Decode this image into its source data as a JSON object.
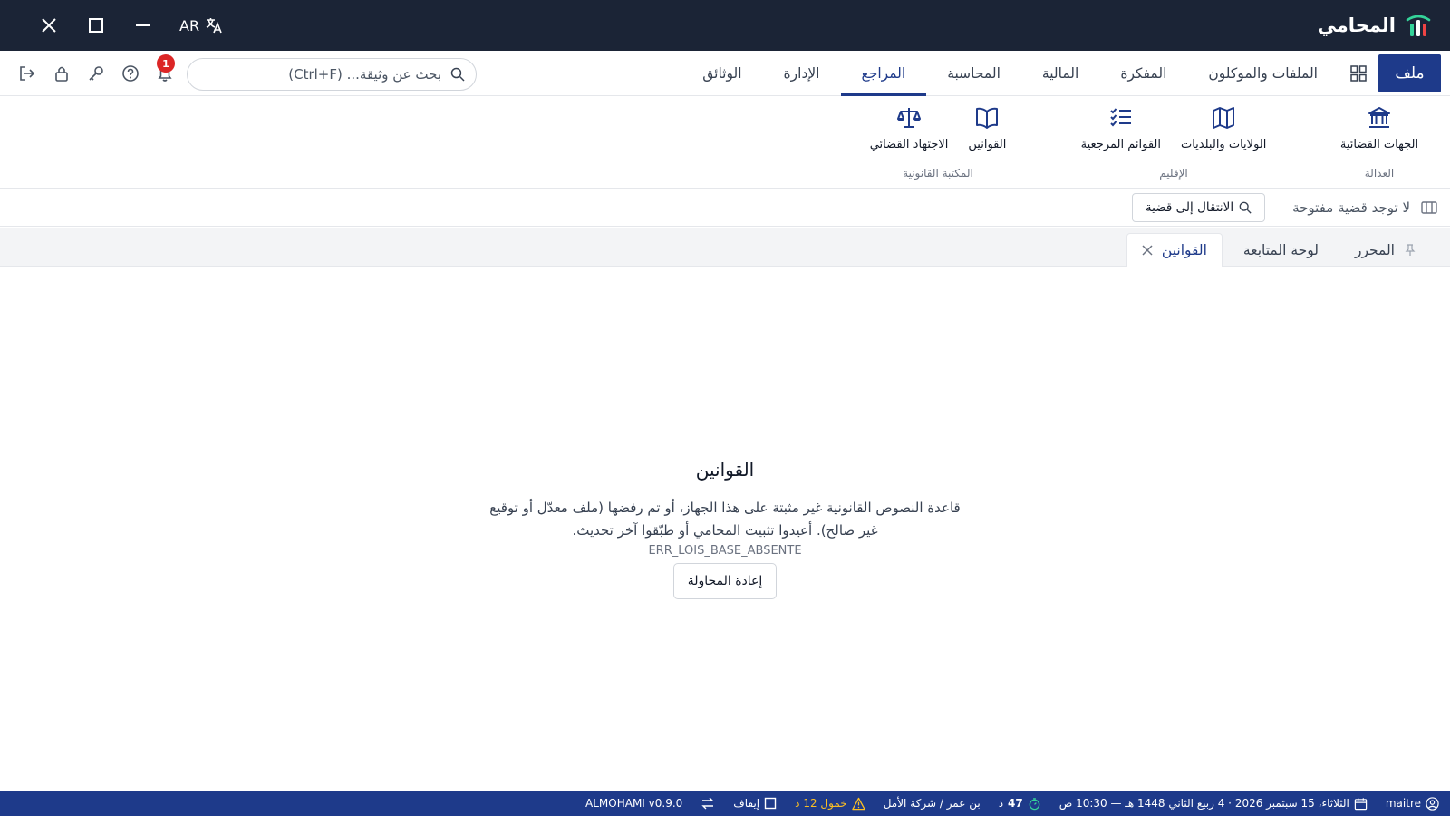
{
  "app": {
    "name": "المحامي",
    "lang_label": "AR",
    "colors": {
      "titlebar": "#1b2436",
      "accent": "#1e3a8a",
      "statusbar": "#1e3a8a",
      "badge": "#dc2626",
      "warning": "#fbbf24"
    }
  },
  "menu": {
    "file_label": "ملف",
    "tabs": [
      "الملفات والموكلون",
      "المفكرة",
      "المالية",
      "المحاسبة",
      "المراجع",
      "الإدارة",
      "الوثائق"
    ],
    "active_tab": "المراجع",
    "search_placeholder": "بحث عن وثيقة... (Ctrl+F)",
    "notification_count": "1"
  },
  "ribbon": {
    "groups": [
      {
        "label": "العدالة",
        "items": [
          {
            "label": "الجهات القضائية",
            "icon": "courthouse-icon"
          }
        ]
      },
      {
        "label": "الإقليم",
        "items": [
          {
            "label": "الولايات والبلديات",
            "icon": "map-icon"
          },
          {
            "label": "القوائم المرجعية",
            "icon": "checklist-icon"
          }
        ]
      },
      {
        "label": "المكتبة القانونية",
        "items": [
          {
            "label": "القوانين",
            "icon": "book-icon"
          },
          {
            "label": "الاجتهاد القضائي",
            "icon": "scales-icon"
          }
        ]
      }
    ]
  },
  "casebar": {
    "no_case_text": "لا توجد قضية مفتوحة",
    "goto_case_label": "الانتقال إلى قضية"
  },
  "doc_tabs": {
    "pinned": "المحرر",
    "tabs": [
      "لوحة المتابعة",
      "القوانين"
    ],
    "active": "القوانين"
  },
  "error": {
    "title": "القوانين",
    "message": "قاعدة النصوص القانونية غير مثبتة على هذا الجهاز، أو تم رفضها (ملف معدّل أو توقيع غير صالح). أعيدوا تثبيت المحامي أو طبّقوا آخر تحديث.",
    "code": "ERR_LOIS_BASE_ABSENTE",
    "retry_label": "إعادة المحاولة"
  },
  "status": {
    "user": "maitre",
    "date": "الثلاثاء، 15 سبتمبر 2026 · 4 ربيع الثاني 1448 هـ — 10:30 ص",
    "timer_value": "47",
    "timer_unit": "د",
    "office": "بن عمر / شركة الأمل",
    "idle_warning": "خمول 12 د",
    "stop_label": "إيقاف",
    "version": "ALMOHAMI v0.9.0"
  }
}
